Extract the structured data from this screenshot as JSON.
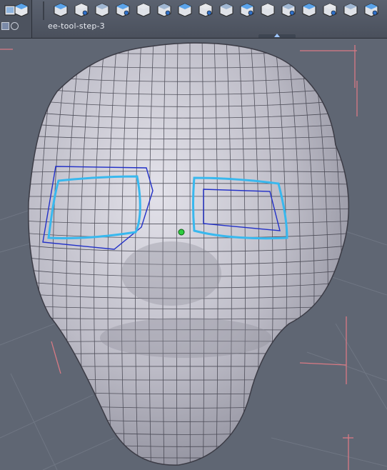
{
  "toolbar": {
    "tab_label": "ee-tool-step-3",
    "left_tools": [
      "view-icon",
      "cube-icon"
    ],
    "mode_buttons": [
      "select-mode-icon",
      "lasso-mode-icon"
    ],
    "tools": [
      "move-icon",
      "scale-icon",
      "rotate-icon",
      "flip-icon",
      "extrude-icon",
      "bevel-icon",
      "bridge-icon",
      "smooth-icon",
      "knife-icon",
      "weld-icon",
      "mirror-icon",
      "lattice-icon",
      "shell-icon",
      "taper-icon",
      "bend-icon",
      "extra-icon"
    ]
  },
  "viewport": {
    "background": "#5f6673",
    "model": "head",
    "selection_color": "#38b8ee",
    "loop_color": "#2230c8",
    "pivot_color": "#2ecc40"
  }
}
